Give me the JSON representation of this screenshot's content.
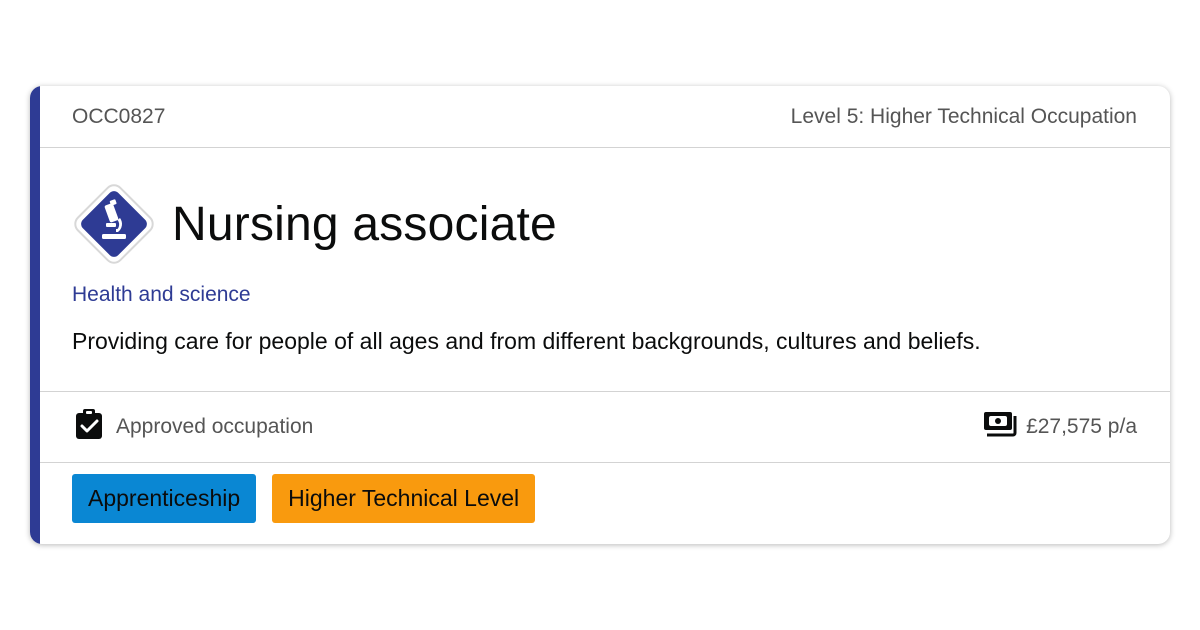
{
  "card": {
    "code": "OCC0827",
    "level": "Level 5: Higher Technical Occupation",
    "title": "Nursing associate",
    "route_icon": "microscope-icon",
    "category": "Health and science",
    "description": "Providing care for people of all ages and from different backgrounds, cultures and beliefs.",
    "status": {
      "icon": "clipboard-check-icon",
      "label": "Approved occupation"
    },
    "salary": {
      "icon": "money-icon",
      "label": "£27,575 p/a"
    },
    "tags": [
      {
        "label": "Apprenticeship",
        "color": "#0a87d3"
      },
      {
        "label": "Higher Technical Level",
        "color": "#f99a0e"
      }
    ]
  },
  "colors": {
    "accent": "#2e3b94",
    "category_text": "#2e3b94",
    "muted_text": "#555555",
    "body_text": "#0b0c0c"
  }
}
